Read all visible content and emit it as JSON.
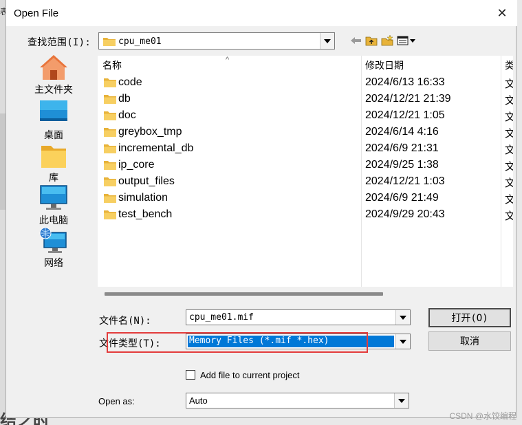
{
  "background": {
    "left_char": "表",
    "bottom_text": "结之时"
  },
  "dialog": {
    "title": "Open File",
    "close_glyph": "✕"
  },
  "lookin": {
    "label": "查找范围(I):",
    "value": "cpu_me01"
  },
  "toolbar": {
    "back_icon": "back-arrow-icon",
    "up_icon": "up-folder-icon",
    "new_folder_icon": "new-folder-icon",
    "view_icon": "view-menu-icon"
  },
  "places": [
    {
      "label": "主文件夹",
      "icon": "home-icon"
    },
    {
      "label": "桌面",
      "icon": "desktop-icon"
    },
    {
      "label": "库",
      "icon": "library-icon"
    },
    {
      "label": "此电脑",
      "icon": "computer-icon"
    },
    {
      "label": "网络",
      "icon": "network-icon"
    }
  ],
  "filelist": {
    "columns": [
      "名称",
      "修改日期",
      "类"
    ],
    "rows": [
      {
        "name": "code",
        "date": "2024/6/13 16:33",
        "type": "文"
      },
      {
        "name": "db",
        "date": "2024/12/21 21:39",
        "type": "文"
      },
      {
        "name": "doc",
        "date": "2024/12/21 1:05",
        "type": "文"
      },
      {
        "name": "greybox_tmp",
        "date": "2024/6/14 4:16",
        "type": "文"
      },
      {
        "name": "incremental_db",
        "date": "2024/6/9 21:31",
        "type": "文"
      },
      {
        "name": "ip_core",
        "date": "2024/9/25 1:38",
        "type": "文"
      },
      {
        "name": "output_files",
        "date": "2024/12/21 1:03",
        "type": "文"
      },
      {
        "name": "simulation",
        "date": "2024/6/9 21:49",
        "type": "文"
      },
      {
        "name": "test_bench",
        "date": "2024/9/29 20:43",
        "type": "文"
      }
    ]
  },
  "filename": {
    "label": "文件名(N):",
    "value": "cpu_me01.mif"
  },
  "filetype": {
    "label": "文件类型(T):",
    "value": "Memory Files (*.mif *.hex)"
  },
  "buttons": {
    "open": "打开(O)",
    "cancel": "取消"
  },
  "add_to_project": {
    "label": "Add file to current project",
    "checked": false
  },
  "open_as": {
    "label": "Open as:",
    "value": "Auto"
  },
  "watermark": "CSDN @水饺编程",
  "colors": {
    "selection": "#0078d7",
    "highlight_box": "#e33b3b",
    "folder": "#f2c14e"
  }
}
